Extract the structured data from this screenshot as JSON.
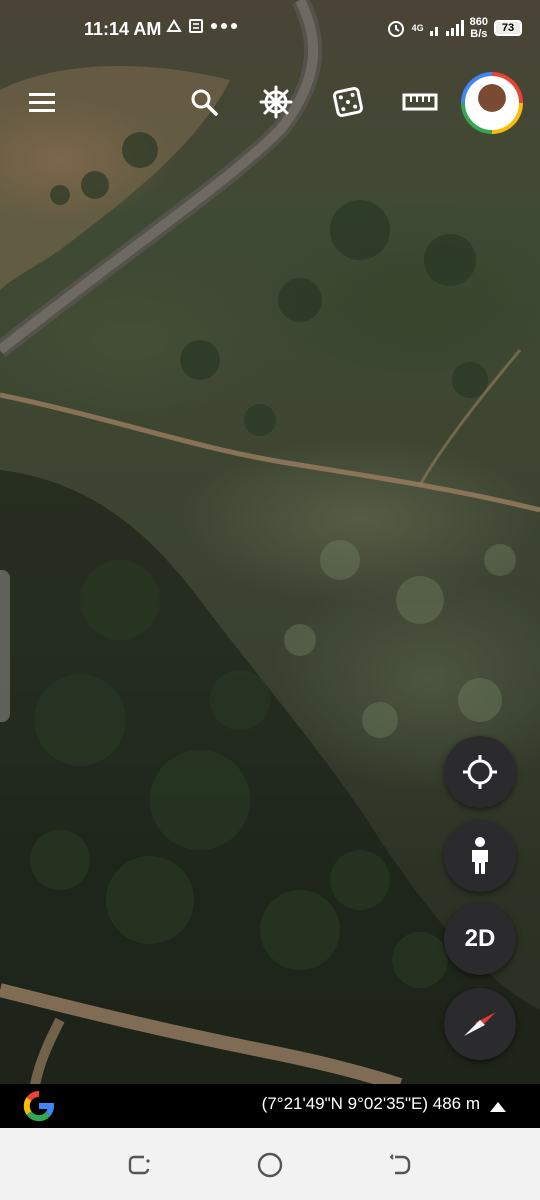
{
  "status_bar": {
    "time": "11:14 AM",
    "net_label": "4G",
    "net_speed_value": "860",
    "net_speed_unit": "B/s",
    "battery": "73"
  },
  "toolbar": {
    "menu_icon": "hamburger-menu-icon",
    "search_icon": "search-icon",
    "voyager_icon": "ship-wheel-icon",
    "feeling_lucky_icon": "dice-icon",
    "measure_icon": "ruler-icon"
  },
  "controls": {
    "my_location_icon": "crosshair-icon",
    "street_view_icon": "pegman-icon",
    "view_mode_label": "2D",
    "compass_icon": "compass-icon"
  },
  "info_bar": {
    "coordinates": "(7°21'49\"N 9°02'35\"E) 486 m"
  },
  "colors": {
    "fab_background": "#2b2b2d",
    "compass_red": "#e53935",
    "nav_bar": "#f2f2f2"
  }
}
